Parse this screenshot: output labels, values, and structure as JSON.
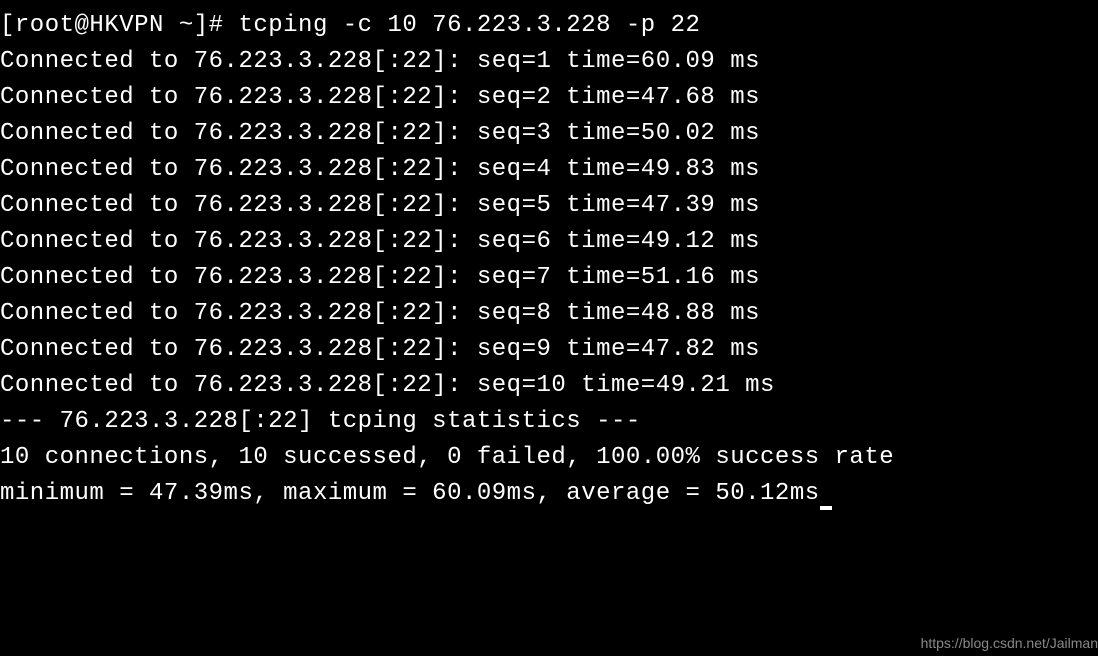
{
  "prompt": {
    "text": "[root@HKVPN ~]# tcping -c 10 76.223.3.228 -p 22"
  },
  "connections": [
    {
      "text": "Connected to 76.223.3.228[:22]: seq=1 time=60.09 ms"
    },
    {
      "text": "Connected to 76.223.3.228[:22]: seq=2 time=47.68 ms"
    },
    {
      "text": "Connected to 76.223.3.228[:22]: seq=3 time=50.02 ms"
    },
    {
      "text": "Connected to 76.223.3.228[:22]: seq=4 time=49.83 ms"
    },
    {
      "text": "Connected to 76.223.3.228[:22]: seq=5 time=47.39 ms"
    },
    {
      "text": "Connected to 76.223.3.228[:22]: seq=6 time=49.12 ms"
    },
    {
      "text": "Connected to 76.223.3.228[:22]: seq=7 time=51.16 ms"
    },
    {
      "text": "Connected to 76.223.3.228[:22]: seq=8 time=48.88 ms"
    },
    {
      "text": "Connected to 76.223.3.228[:22]: seq=9 time=47.82 ms"
    },
    {
      "text": "Connected to 76.223.3.228[:22]: seq=10 time=49.21 ms"
    }
  ],
  "blank_line": "",
  "stats_header": "--- 76.223.3.228[:22] tcping statistics ---",
  "stats_line1": "10 connections, 10 successed, 0 failed, 100.00% success rate",
  "stats_line2": "minimum = 47.39ms, maximum = 60.09ms, average = 50.12ms",
  "watermark": "https://blog.csdn.net/Jailman"
}
